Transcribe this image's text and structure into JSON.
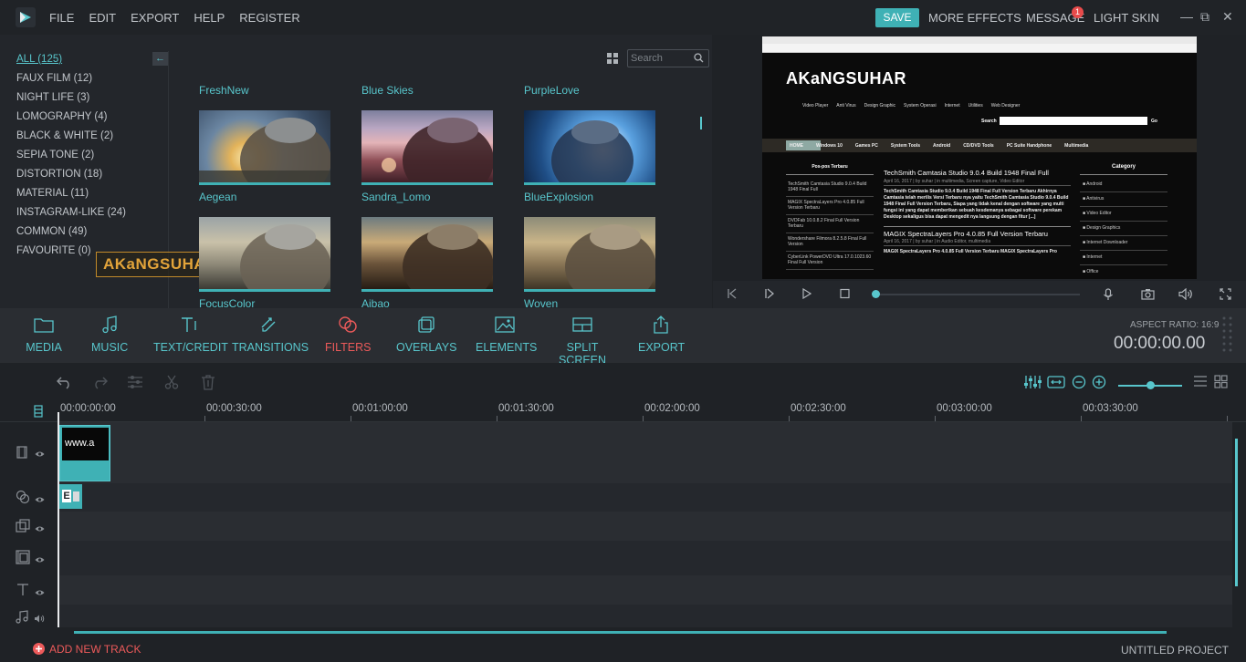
{
  "menu": [
    "FILE",
    "EDIT",
    "EXPORT",
    "HELP",
    "REGISTER"
  ],
  "top_right": {
    "save": "SAVE",
    "more_effects": "MORE EFFECTS",
    "message": "MESSAGE",
    "message_badge": "1",
    "light_skin": "LIGHT SKIN"
  },
  "categories": [
    "ALL (125)",
    "FAUX FILM (12)",
    "NIGHT LIFE (3)",
    "LOMOGRAPHY (4)",
    "BLACK & WHITE (2)",
    "SEPIA TONE (2)",
    "DISTORTION (18)",
    "MATERIAL (11)",
    "INSTAGRAM-LIKE (24)",
    "COMMON (49)",
    "FAVOURITE (0)"
  ],
  "watermark": "AKaNGSUHAR",
  "search": {
    "placeholder": "Search"
  },
  "filters": {
    "row0_titles": [
      "FreshNew",
      "Blue Skies",
      "PurpleLove"
    ],
    "row1_titles": [
      "Aegean",
      "Sandra_Lomo",
      "BlueExplosion"
    ],
    "row2_titles": [
      "FocusColor",
      "Aibao",
      "Woven"
    ]
  },
  "preview_site": {
    "brand": "AKaNGSUHAR",
    "nav": [
      "Video Player",
      "Anti Virus",
      "Design Graphic",
      "System Operasi",
      "Internet",
      "Utilities",
      "Web Designer"
    ],
    "search_label": "Search",
    "go": "Go",
    "tabs": [
      "HOME",
      "Windows 10",
      "Games PC",
      "System Tools",
      "Android",
      "CD/DVD Tools",
      "PC Suite Handphone",
      "Multimedia"
    ],
    "left_heading": "Pos-pos Terbaru",
    "left_items": [
      "TechSmith Camtasia Studio 9.0.4 Build 1948 Final Full",
      "MAGIX SpectraLayers Pro 4.0.85 Full Version Terbaru",
      "DVDFab 10.0.8.2 Final Full Version Terbaru",
      "Wondershare Filmora 8.2.5.8 Final Full Version",
      "CyberLink PowerDVD Ultra 17.0.1023.60 Final Full Version"
    ],
    "post1_title": "TechSmith Camtasia Studio 9.0.4 Build 1948 Final Full",
    "post1_meta": "April 16, 2017 | by suhar | in multimedia, Screen capture, Video Editor",
    "post1_body": "TechSmith Camtasia Studio 9.0.4 Build 1948 Final Full Version Terbaru Akhirnya Camtasia telah merilis Versi Terbaru nya yaitu TechSmith Camtasia Studio 9.0.4 Build 1948 Final Full Version Terbaru, Siapa yang tidak kenal dengan software yang multi fungsi ini yang dapat memberikan sebuah kesdemanya sebagai software perekam Desktop sekaligus bisa dapat mengedit nya langsung dengan fitur [...]",
    "post2_title": "MAGIX SpectraLayers Pro 4.0.85 Full Version Terbaru",
    "post2_meta": "April 16, 2017 | by suhar | in Audio Editor, multimedia",
    "post2_body": "MAGIX SpectraLayers Pro 4.0.85 Full Version Terbaru MAGIX SpectraLayers Pro",
    "right_heading": "Category",
    "right_items": [
      "Android",
      "Antivirus",
      "Video Editor",
      "Design Graphics",
      "Internet Downloader",
      "Internet",
      "Office"
    ]
  },
  "toolbar": {
    "items": [
      "MEDIA",
      "MUSIC",
      "TEXT/CREDIT",
      "TRANSITIONS",
      "FILTERS",
      "OVERLAYS",
      "ELEMENTS",
      "SPLIT SCREEN",
      "EXPORT"
    ],
    "active": "FILTERS",
    "aspect_ratio": "ASPECT RATIO: 16:9",
    "timecode": "00:00:00.00"
  },
  "ruler": [
    "00:00:00:00",
    "00:00:30:00",
    "00:01:00:00",
    "00:01:30:00",
    "00:02:00:00",
    "00:02:30:00",
    "00:03:00:00",
    "00:03:30:00"
  ],
  "clips": {
    "video_clip_text": "www.a",
    "filter_clip_text": "E"
  },
  "bottom": {
    "add_track": "ADD NEW TRACK",
    "project": "UNTITLED PROJECT"
  },
  "colors": {
    "accent": "#3fb1b5",
    "active": "#ec5a5a",
    "watermark": "#e3a43a"
  }
}
